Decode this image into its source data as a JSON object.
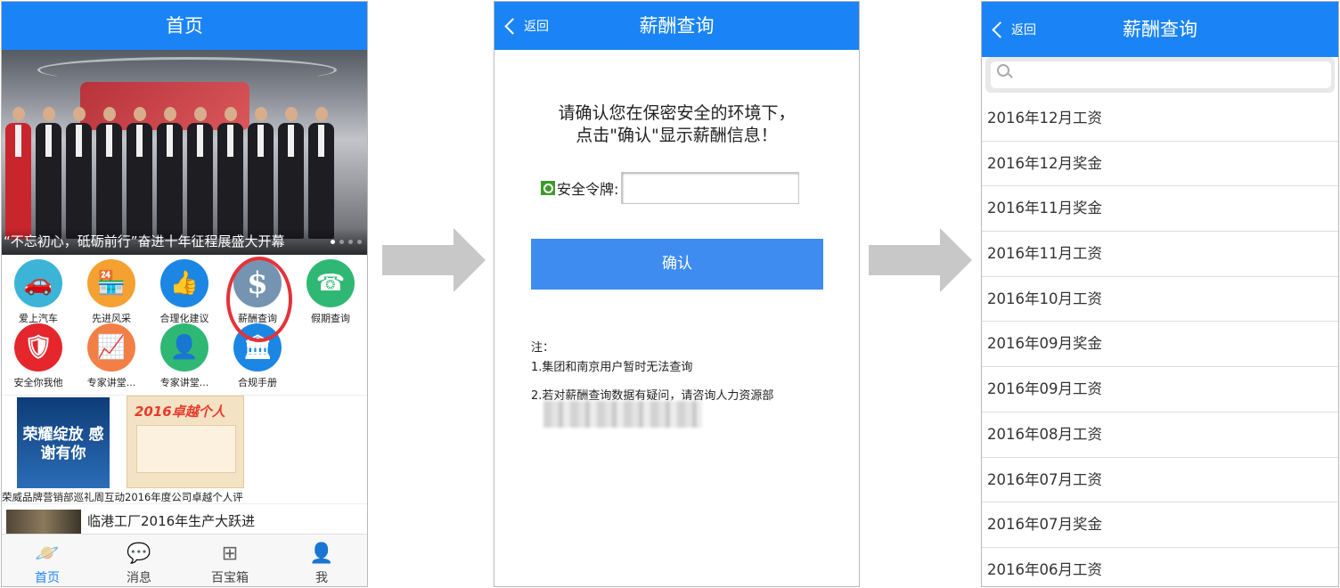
{
  "screen1": {
    "title": "首页",
    "banner_caption": "“不忘初心，砥砺前行”奋进十年征程展盛大开幕",
    "icons": [
      {
        "label": "爱上汽车",
        "icon": "car-icon",
        "color": "#3cb4d8",
        "glyph": "🚗"
      },
      {
        "label": "先进风采",
        "icon": "shop-icon",
        "color": "#f4a132",
        "glyph": "🏪"
      },
      {
        "label": "合理化建议",
        "icon": "thumbs-up-icon",
        "color": "#1b86e3",
        "glyph": "👍"
      },
      {
        "label": "薪酬查询",
        "icon": "dollar-icon",
        "color": "#7594b2",
        "glyph": "$"
      },
      {
        "label": "假期查询",
        "icon": "clock-24-icon",
        "color": "#2fb874",
        "glyph": "☎"
      },
      {
        "label": "安全你我他",
        "icon": "shield-icon",
        "color": "#e5262c",
        "glyph": "🛡"
      },
      {
        "label": "专家讲堂...",
        "icon": "chart-up-icon",
        "color": "#f27f45",
        "glyph": "📈"
      },
      {
        "label": "专家讲堂...",
        "icon": "person-icon",
        "color": "#2fb874",
        "glyph": "👤"
      },
      {
        "label": "合规手册",
        "icon": "bank-icon",
        "color": "#1b86e3",
        "glyph": "🏛"
      }
    ],
    "news1": {
      "img1_text": "荣耀绽放 感谢有你",
      "img2_title": "2016卓越个人",
      "caption": "荣威品牌营销部巡礼周互动2016年度公司卓越个人评"
    },
    "news2": "临港工厂2016年生产大跃进",
    "tabs": [
      {
        "label": "首页",
        "icon": "planet-icon",
        "glyph": "🪐",
        "active": true
      },
      {
        "label": "消息",
        "icon": "chat-icon",
        "glyph": "💬",
        "active": false
      },
      {
        "label": "百宝箱",
        "icon": "grid-icon",
        "glyph": "⊞",
        "active": false
      },
      {
        "label": "我",
        "icon": "user-icon",
        "glyph": "👤",
        "active": false
      }
    ]
  },
  "screen2": {
    "back": "返回",
    "title": "薪酬查询",
    "notice_line1": "请确认您在保密安全的环境下，",
    "notice_line2": "点击\"确认\"显示薪酬信息！",
    "token_label": "安全令牌:",
    "token_value": "",
    "confirm": "确认",
    "note_head": "注：",
    "note1": "1.集团和南京用户暂时无法查询",
    "note2": "2.若对薪酬查询数据有疑问，请咨询人力资源部"
  },
  "screen3": {
    "back": "返回",
    "title": "薪酬查询",
    "search_placeholder": "",
    "items": [
      "2016年12月工资",
      "2016年12月奖金",
      "2016年11月奖金",
      "2016年11月工资",
      "2016年10月工资",
      "2016年09月奖金",
      "2016年09月工资",
      "2016年08月工资",
      "2016年07月工资",
      "2016年07月奖金",
      "2016年06月工资"
    ]
  }
}
